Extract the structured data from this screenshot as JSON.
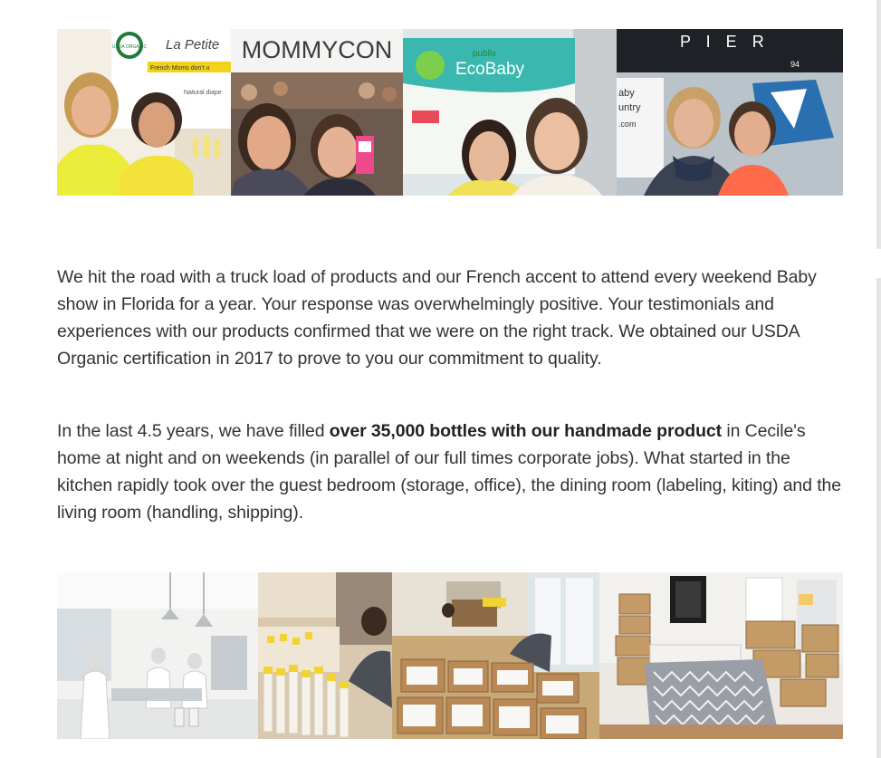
{
  "photos_top": {
    "p1": {
      "sign_brand": "La Petite",
      "sign_badge": "USDA ORGANIC",
      "sign_line1": "French Moms don't u",
      "sign_line2": "Natural diape"
    },
    "p2": {
      "sign_title": "MOMMYCON"
    },
    "p3": {
      "sign_small": "publix",
      "sign_title": "EcoBaby"
    },
    "p4": {
      "sign_letters": "P I E R",
      "sign_number": "94",
      "sign_side1": "aby",
      "sign_side2": "untry",
      "sign_side3": ".com"
    }
  },
  "paragraph1": "We hit the road with a truck load of products and our French accent to attend every weekend Baby show in Florida for a year. Your response was overwhelmingly positive. Your testimonials and experiences with our products confirmed that we were on the right track. We obtained our USDA Organic certification in 2017 to prove to you our commitment to quality.",
  "paragraph2": {
    "before": "In the last 4.5 years, we have filled ",
    "bold": "over 35,000 bottles with our handmade product",
    "after": " in Cecile's home at night and on weekends (in parallel of our full times corporate jobs). What started in the kitchen rapidly took over the guest bedroom (storage, office), the dining room (labeling, kiting) and the living room (handling, shipping)."
  },
  "colors": {
    "text": "#333333",
    "bold_text": "#222222",
    "background": "#ffffff"
  }
}
